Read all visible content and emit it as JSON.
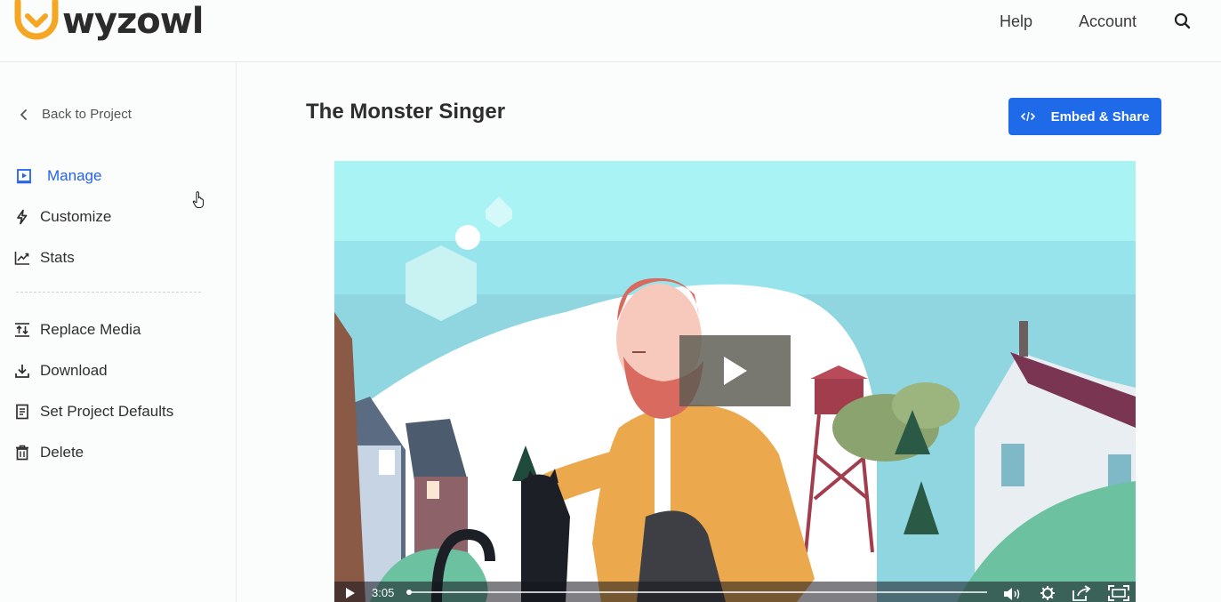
{
  "brand": {
    "name": "wyzowl",
    "accent": "#f5a623"
  },
  "header": {
    "help": "Help",
    "account": "Account",
    "search_icon": "search-icon"
  },
  "sidebar": {
    "back": "Back to Project",
    "items": [
      {
        "label": "Manage",
        "icon": "play-box-icon",
        "active": true
      },
      {
        "label": "Customize",
        "icon": "lightning-icon"
      },
      {
        "label": "Stats",
        "icon": "chart-line-icon"
      },
      {
        "label": "Replace Media",
        "icon": "replace-icon"
      },
      {
        "label": "Download",
        "icon": "download-icon"
      },
      {
        "label": "Set Project Defaults",
        "icon": "document-icon"
      },
      {
        "label": "Delete",
        "icon": "trash-icon"
      }
    ]
  },
  "main": {
    "title": "The Monster Singer",
    "embed_button": "Embed & Share",
    "video": {
      "time": "3:05",
      "progress": 0.0
    }
  },
  "colors": {
    "primary": "#1f6ae8",
    "active_text": "#2563eb",
    "sky": "#a5eef2"
  }
}
